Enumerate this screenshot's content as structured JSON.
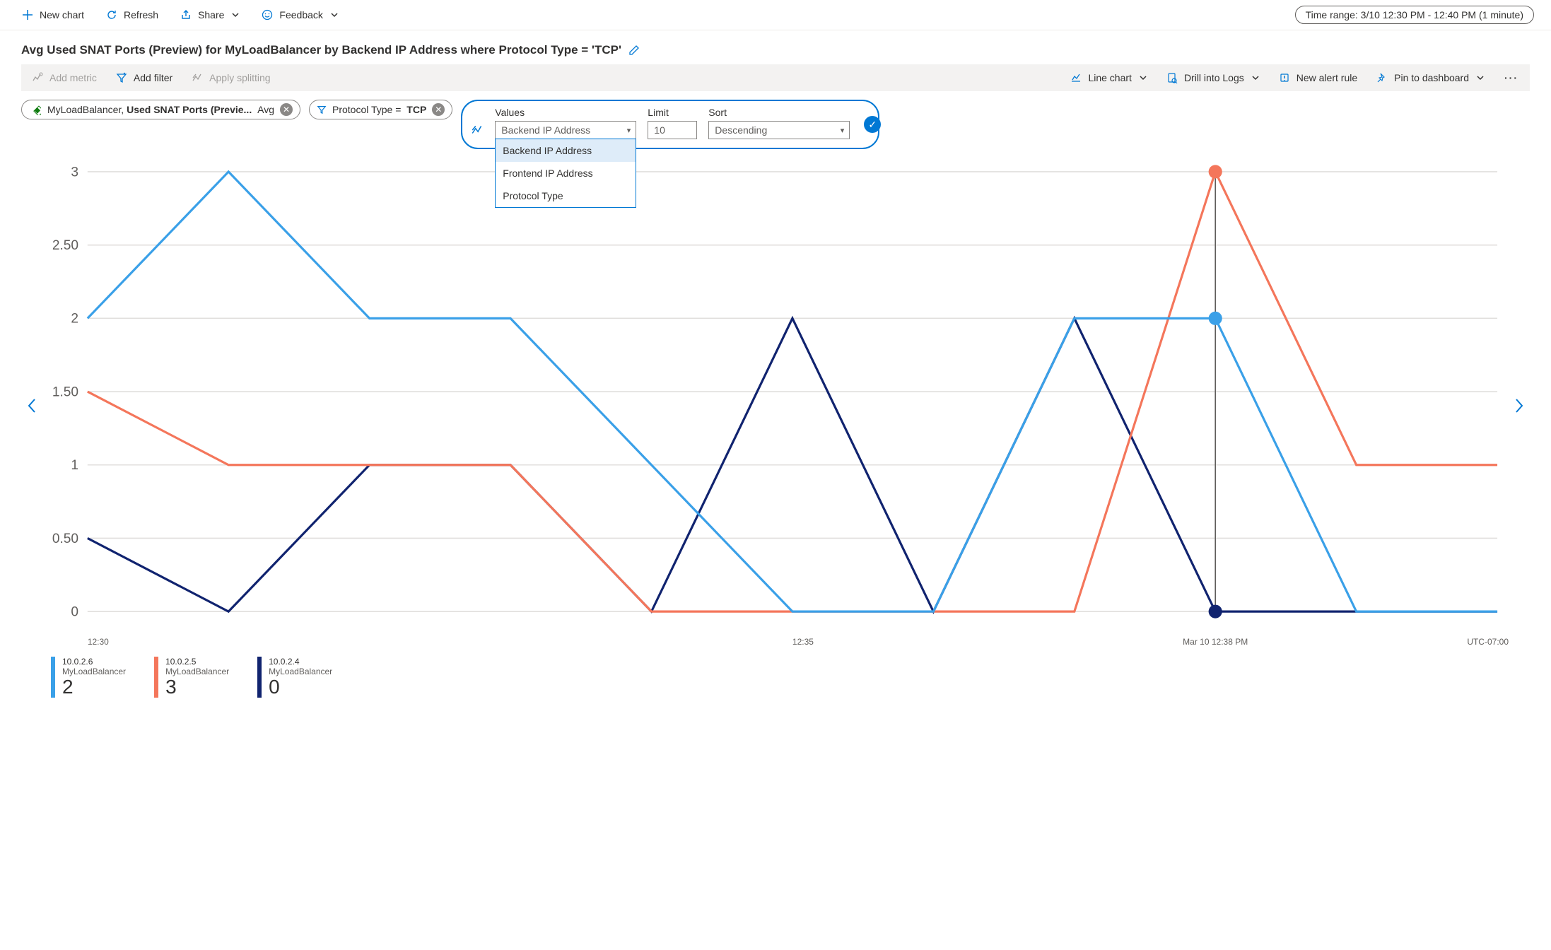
{
  "toolbar": {
    "new_chart": "New chart",
    "refresh": "Refresh",
    "share": "Share",
    "feedback": "Feedback",
    "time_range": "Time range: 3/10 12:30 PM - 12:40 PM (1 minute)"
  },
  "title": "Avg Used SNAT Ports (Preview) for MyLoadBalancer by Backend IP Address where Protocol Type = 'TCP'",
  "sub_toolbar": {
    "add_metric": "Add metric",
    "add_filter": "Add filter",
    "apply_splitting": "Apply splitting",
    "chart_type": "Line chart",
    "drill_logs": "Drill into Logs",
    "new_alert": "New alert rule",
    "pin_dashboard": "Pin to dashboard"
  },
  "chips": {
    "metric_resource": "MyLoadBalancer,",
    "metric_name": "Used SNAT Ports (Previe...",
    "metric_agg": "Avg",
    "filter_text": "Protocol Type =",
    "filter_value": "TCP"
  },
  "split": {
    "values_label": "Values",
    "values_selected": "Backend IP Address",
    "values_options": [
      "Backend IP Address",
      "Frontend IP Address",
      "Protocol Type"
    ],
    "limit_label": "Limit",
    "limit_value": "10",
    "sort_label": "Sort",
    "sort_value": "Descending"
  },
  "chart_data": {
    "type": "line",
    "ylim": [
      0,
      3
    ],
    "y_ticks": [
      "0",
      "0.50",
      "1",
      "1.50",
      "2",
      "2.50",
      "3"
    ],
    "x_ticks": [
      {
        "pos": 0,
        "label": "12:30"
      },
      {
        "pos": 5,
        "label": "12:35"
      }
    ],
    "hover_x": 8,
    "hover_label": "Mar 10 12:38 PM",
    "tz": "UTC-07:00",
    "series": [
      {
        "name": "10.0.2.6",
        "resource": "MyLoadBalancer",
        "color": "#3aa0e8",
        "last": "2",
        "values": [
          2,
          3,
          2,
          2,
          1,
          0,
          0,
          2,
          2,
          0,
          0
        ]
      },
      {
        "name": "10.0.2.5",
        "resource": "MyLoadBalancer",
        "color": "#f4765b",
        "last": "3",
        "values": [
          1.5,
          1,
          1,
          1,
          0,
          0,
          0,
          0,
          3,
          1,
          1
        ]
      },
      {
        "name": "10.0.2.4",
        "resource": "MyLoadBalancer",
        "color": "#10236f",
        "last": "0",
        "values": [
          0.5,
          0,
          1,
          1,
          0,
          2,
          0,
          2,
          0,
          0,
          0
        ]
      }
    ]
  }
}
